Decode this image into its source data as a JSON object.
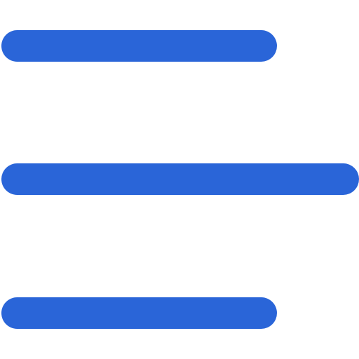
{
  "icon": {
    "name": "menu-icon",
    "color": "#2A65D8"
  }
}
